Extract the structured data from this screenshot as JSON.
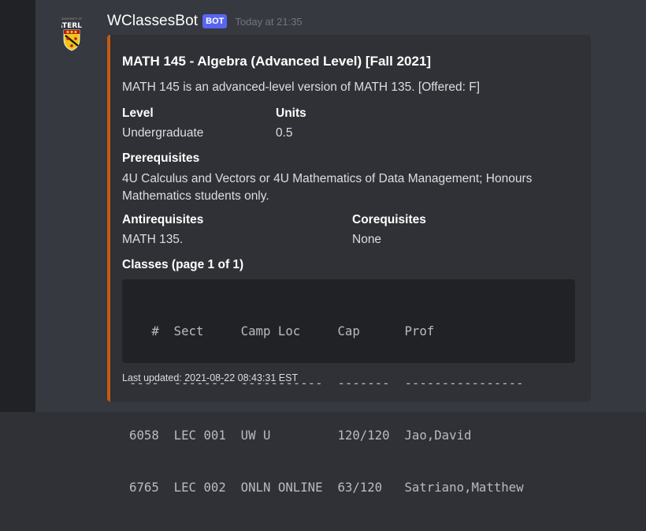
{
  "message": {
    "username": "WClassesBot",
    "bot_tag": "BOT",
    "timestamp": "Today at 21:35"
  },
  "embed": {
    "accent_color": "#c55a11",
    "title": "MATH 145 - Algebra (Advanced Level) [Fall 2021]",
    "description": "MATH 145 is an advanced-level version of MATH 135. [Offered: F]",
    "fields": {
      "level": {
        "name": "Level",
        "value": "Undergraduate"
      },
      "units": {
        "name": "Units",
        "value": "0.5"
      },
      "prerequisites": {
        "name": "Prerequisites",
        "value": "4U Calculus and Vectors or 4U Mathematics of Data Management; Honours Mathematics students only."
      },
      "antirequisites": {
        "name": "Antirequisites",
        "value": "MATH 135."
      },
      "corequisites": {
        "name": "Corequisites",
        "value": "None"
      },
      "classes": {
        "name": "Classes (page 1 of 1)"
      }
    },
    "classes_table": [
      "   #  Sect     Camp Loc     Cap      Prof",
      "----  -------  -----------  -------  ----------------",
      "6058  LEC 001  UW U         120/120  Jao,David",
      "6765  LEC 002  ONLN ONLINE  63/120   Satriano,Matthew"
    ],
    "footer": "Last updated: 2021-08-22 08:43:31 EST"
  },
  "avatar": {
    "icon": "university-crest-icon",
    "text": "WATERLOO"
  }
}
